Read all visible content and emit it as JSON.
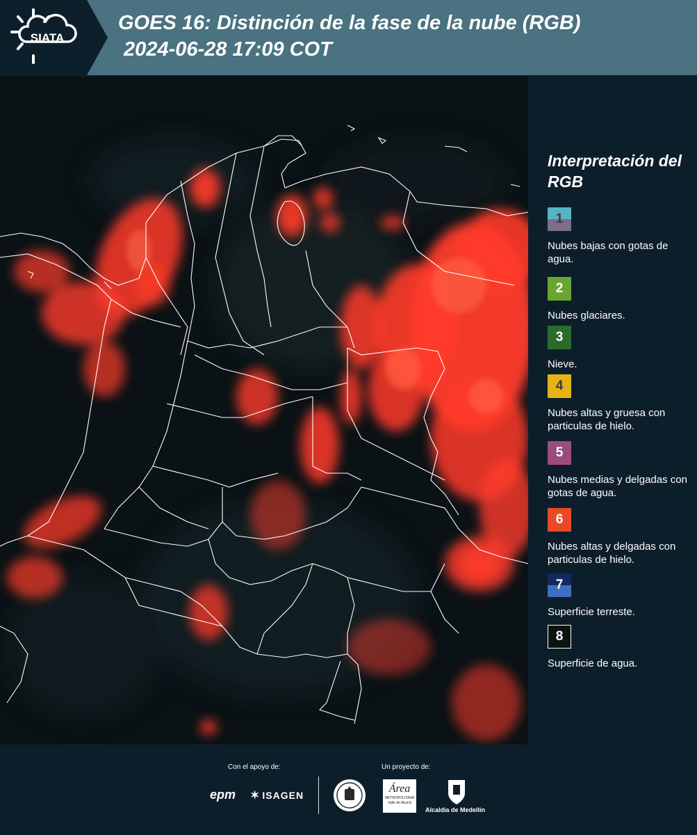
{
  "header": {
    "logo_text": "SIATA",
    "title": "GOES 16: Distinción de la fase de la nube (RGB)\n 2024-06-28 17:09 COT"
  },
  "legend": {
    "title": "Interpretación del RGB",
    "items": [
      {
        "num": "1",
        "text": "Nubes bajas con gotas de agua.",
        "color_top": "#5ab3c4",
        "color_bottom": "#7a6e89",
        "num_color": "#3a3a48"
      },
      {
        "num": "2",
        "text": "Nubes glaciares.",
        "color": "#6aa534",
        "num_color": "#ffffff"
      },
      {
        "num": "3",
        "text": "Nieve.",
        "color": "#2b6c2e",
        "num_color": "#ffffff"
      },
      {
        "num": "4",
        "text": "Nubes altas y gruesa con particulas de hielo.",
        "color": "#e5b318",
        "num_color": "#3a3a3a"
      },
      {
        "num": "5",
        "text": "Nubes medias y delgadas con gotas de agua.",
        "color": "#9a4c7d",
        "num_color": "#ffffff"
      },
      {
        "num": "6",
        "text": "Nubes altas y delgadas con particulas de hielo.",
        "color": "#e84a27",
        "num_color": "#ffffff"
      },
      {
        "num": "7",
        "text": "Superficie terreste.",
        "color_top": "#14275f",
        "color_bottom": "#3f6fc0",
        "num_color": "#ffffff"
      },
      {
        "num": "8",
        "text": "Superficie de agua.",
        "color": "#0a1410",
        "border": "#ffffff",
        "num_color": "#ffffff"
      }
    ]
  },
  "footer": {
    "support_label": "Con el apoyo de:",
    "project_label": "Un proyecto de:",
    "sponsors": [
      "epm",
      "ISAGEN"
    ],
    "partners": [
      "Área Metropolitana Valle de Aburrá",
      "Alcaldía de Medellín"
    ],
    "area_logo_text": "Área",
    "area_sub_text": "METROPOLITANA",
    "area_sub_text2": "Valle de Aburrá",
    "alcaldia_text": "Alcaldía de Medellín"
  },
  "colors": {
    "header_bg": "#4a7280",
    "panel_bg": "#0d1e2b",
    "cloud_red": "#ff3b2a",
    "border_line": "#ffffff"
  }
}
